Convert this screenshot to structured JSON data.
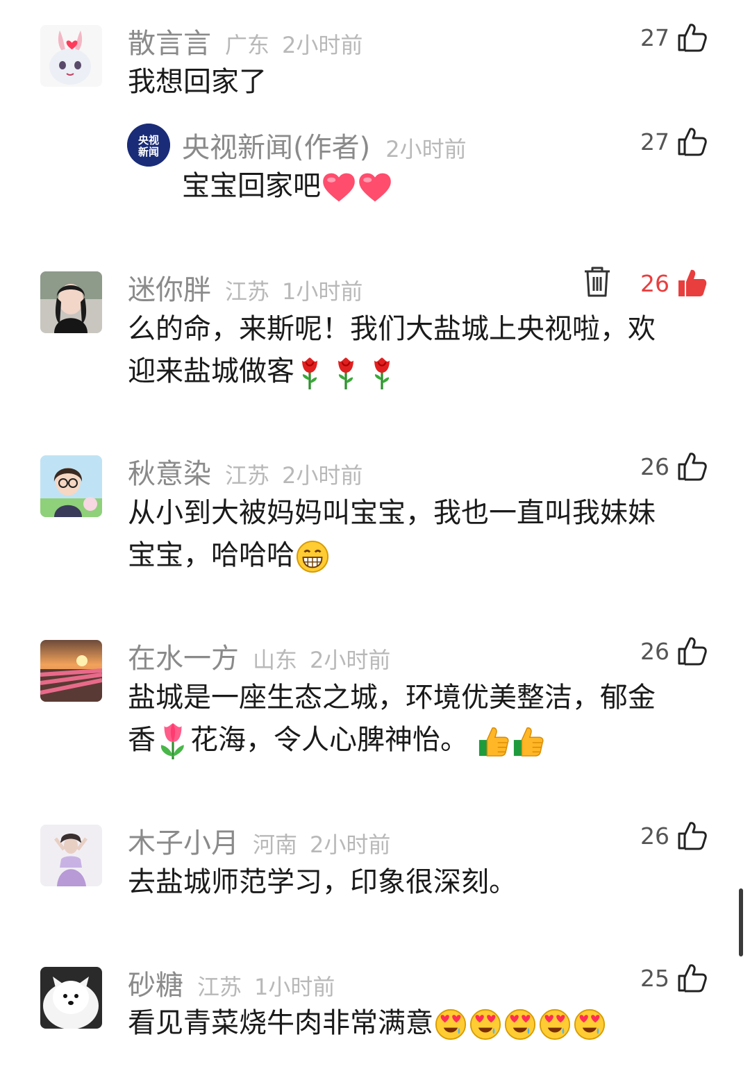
{
  "comments": [
    {
      "user": "散言言",
      "location": "广东",
      "time": "2小时前",
      "likes": "27",
      "text": "我想回家了",
      "reply": {
        "user": "央视新闻(作者)",
        "avatar_text": "央视新闻",
        "time": "2小时前",
        "likes": "27",
        "text": "宝宝回家吧"
      }
    },
    {
      "user": "迷你胖",
      "location": "江苏",
      "time": "1小时前",
      "likes": "26",
      "liked": true,
      "text_line1": "么的命，来斯呢！我们大盐城上央视啦，欢",
      "text_line2": "迎来盐城做客"
    },
    {
      "user": "秋意染",
      "location": "江苏",
      "time": "2小时前",
      "likes": "26",
      "text_line1": "从小到大被妈妈叫宝宝，我也一直叫我妹妹",
      "text_line2": "宝宝，哈哈哈"
    },
    {
      "user": "在水一方",
      "location": "山东",
      "time": "2小时前",
      "likes": "26",
      "text_line1": "盐城是一座生态之城，环境优美整洁，郁金",
      "text_line2a": "香",
      "text_line2b": "花海，令人心脾神怡。"
    },
    {
      "user": "木子小月",
      "location": "河南",
      "time": "2小时前",
      "likes": "26",
      "text": "去盐城师范学习，印象很深刻。"
    },
    {
      "user": "砂糖",
      "location": "江苏",
      "time": "1小时前",
      "likes": "25",
      "text": "看见青菜烧牛肉非常满意"
    }
  ],
  "colors": {
    "like_active": "#e83e3e",
    "meta_gray": "#b8b8b8",
    "name_gray": "#8a8a8a"
  },
  "icons": [
    "thumbs-up-icon",
    "trash-icon",
    "heart-emoji",
    "rose-emoji",
    "tulip-emoji",
    "grin-emoji",
    "thumbs-up-emoji",
    "heart-eyes-emoji"
  ]
}
